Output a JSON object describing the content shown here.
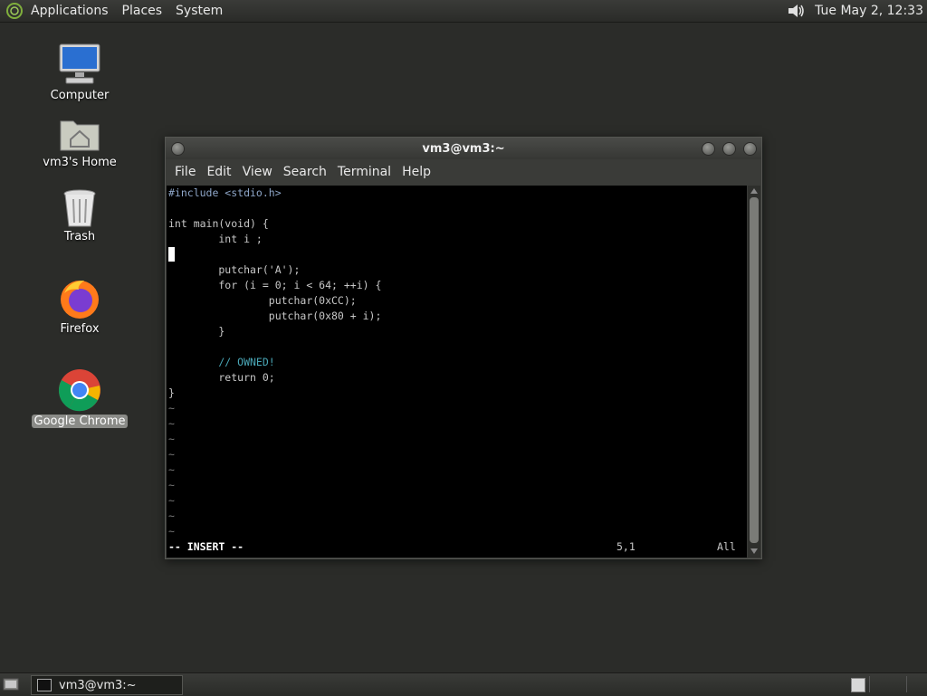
{
  "top_panel": {
    "menus": [
      "Applications",
      "Places",
      "System"
    ],
    "clock": "Tue May  2, 12:33"
  },
  "desktop": {
    "icons": [
      {
        "label": "Computer",
        "icon": "computer-icon"
      },
      {
        "label": "vm3's Home",
        "icon": "home-folder-icon"
      },
      {
        "label": "Trash",
        "icon": "trash-icon"
      },
      {
        "label": "Firefox",
        "icon": "firefox-icon"
      },
      {
        "label": "Google Chrome",
        "icon": "chrome-icon"
      }
    ]
  },
  "window": {
    "title": "vm3@vm3:~",
    "menus": [
      "File",
      "Edit",
      "View",
      "Search",
      "Terminal",
      "Help"
    ]
  },
  "editor": {
    "lines": [
      "#include <stdio.h>",
      "",
      "int main(void) {",
      "        int i ;",
      "",
      "        putchar('A');",
      "        for (i = 0; i < 64; ++i) {",
      "                putchar(0xCC);",
      "                putchar(0x80 + i);",
      "        }",
      "",
      "        // OWNED!",
      "        return 0;",
      "}"
    ],
    "tilde": "~",
    "mode": "-- INSERT --",
    "cursor_pos": "5,1",
    "scroll_pos": "All"
  },
  "taskbar": {
    "task_title": "vm3@vm3:~"
  },
  "colors": {
    "desktop_bg": "#2b2c29",
    "terminal_bg": "#000000",
    "comment": "#4aa8b8"
  }
}
